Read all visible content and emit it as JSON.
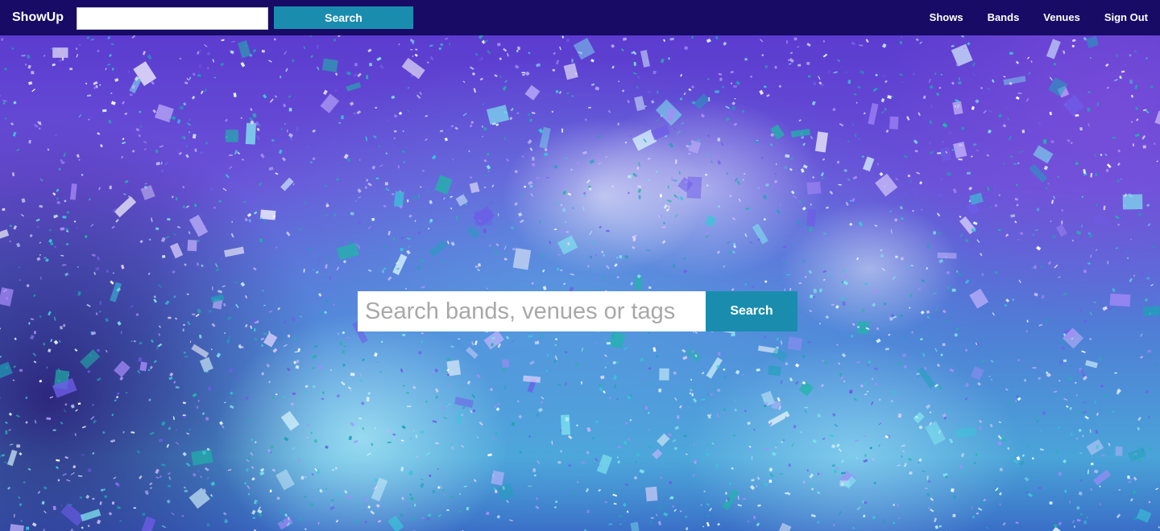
{
  "navbar": {
    "brand": "ShowUp",
    "search_value": "",
    "search_button_label": "Search",
    "links": [
      {
        "label": "Shows"
      },
      {
        "label": "Bands"
      },
      {
        "label": "Venues"
      },
      {
        "label": "Sign Out"
      }
    ]
  },
  "hero": {
    "background_image": "confetti-concert-photo",
    "search": {
      "placeholder": "Search bands, venues or tags",
      "value": "",
      "button_label": "Search"
    }
  },
  "colors": {
    "navbar_bg": "#170b66",
    "accent": "#1a8dae"
  }
}
